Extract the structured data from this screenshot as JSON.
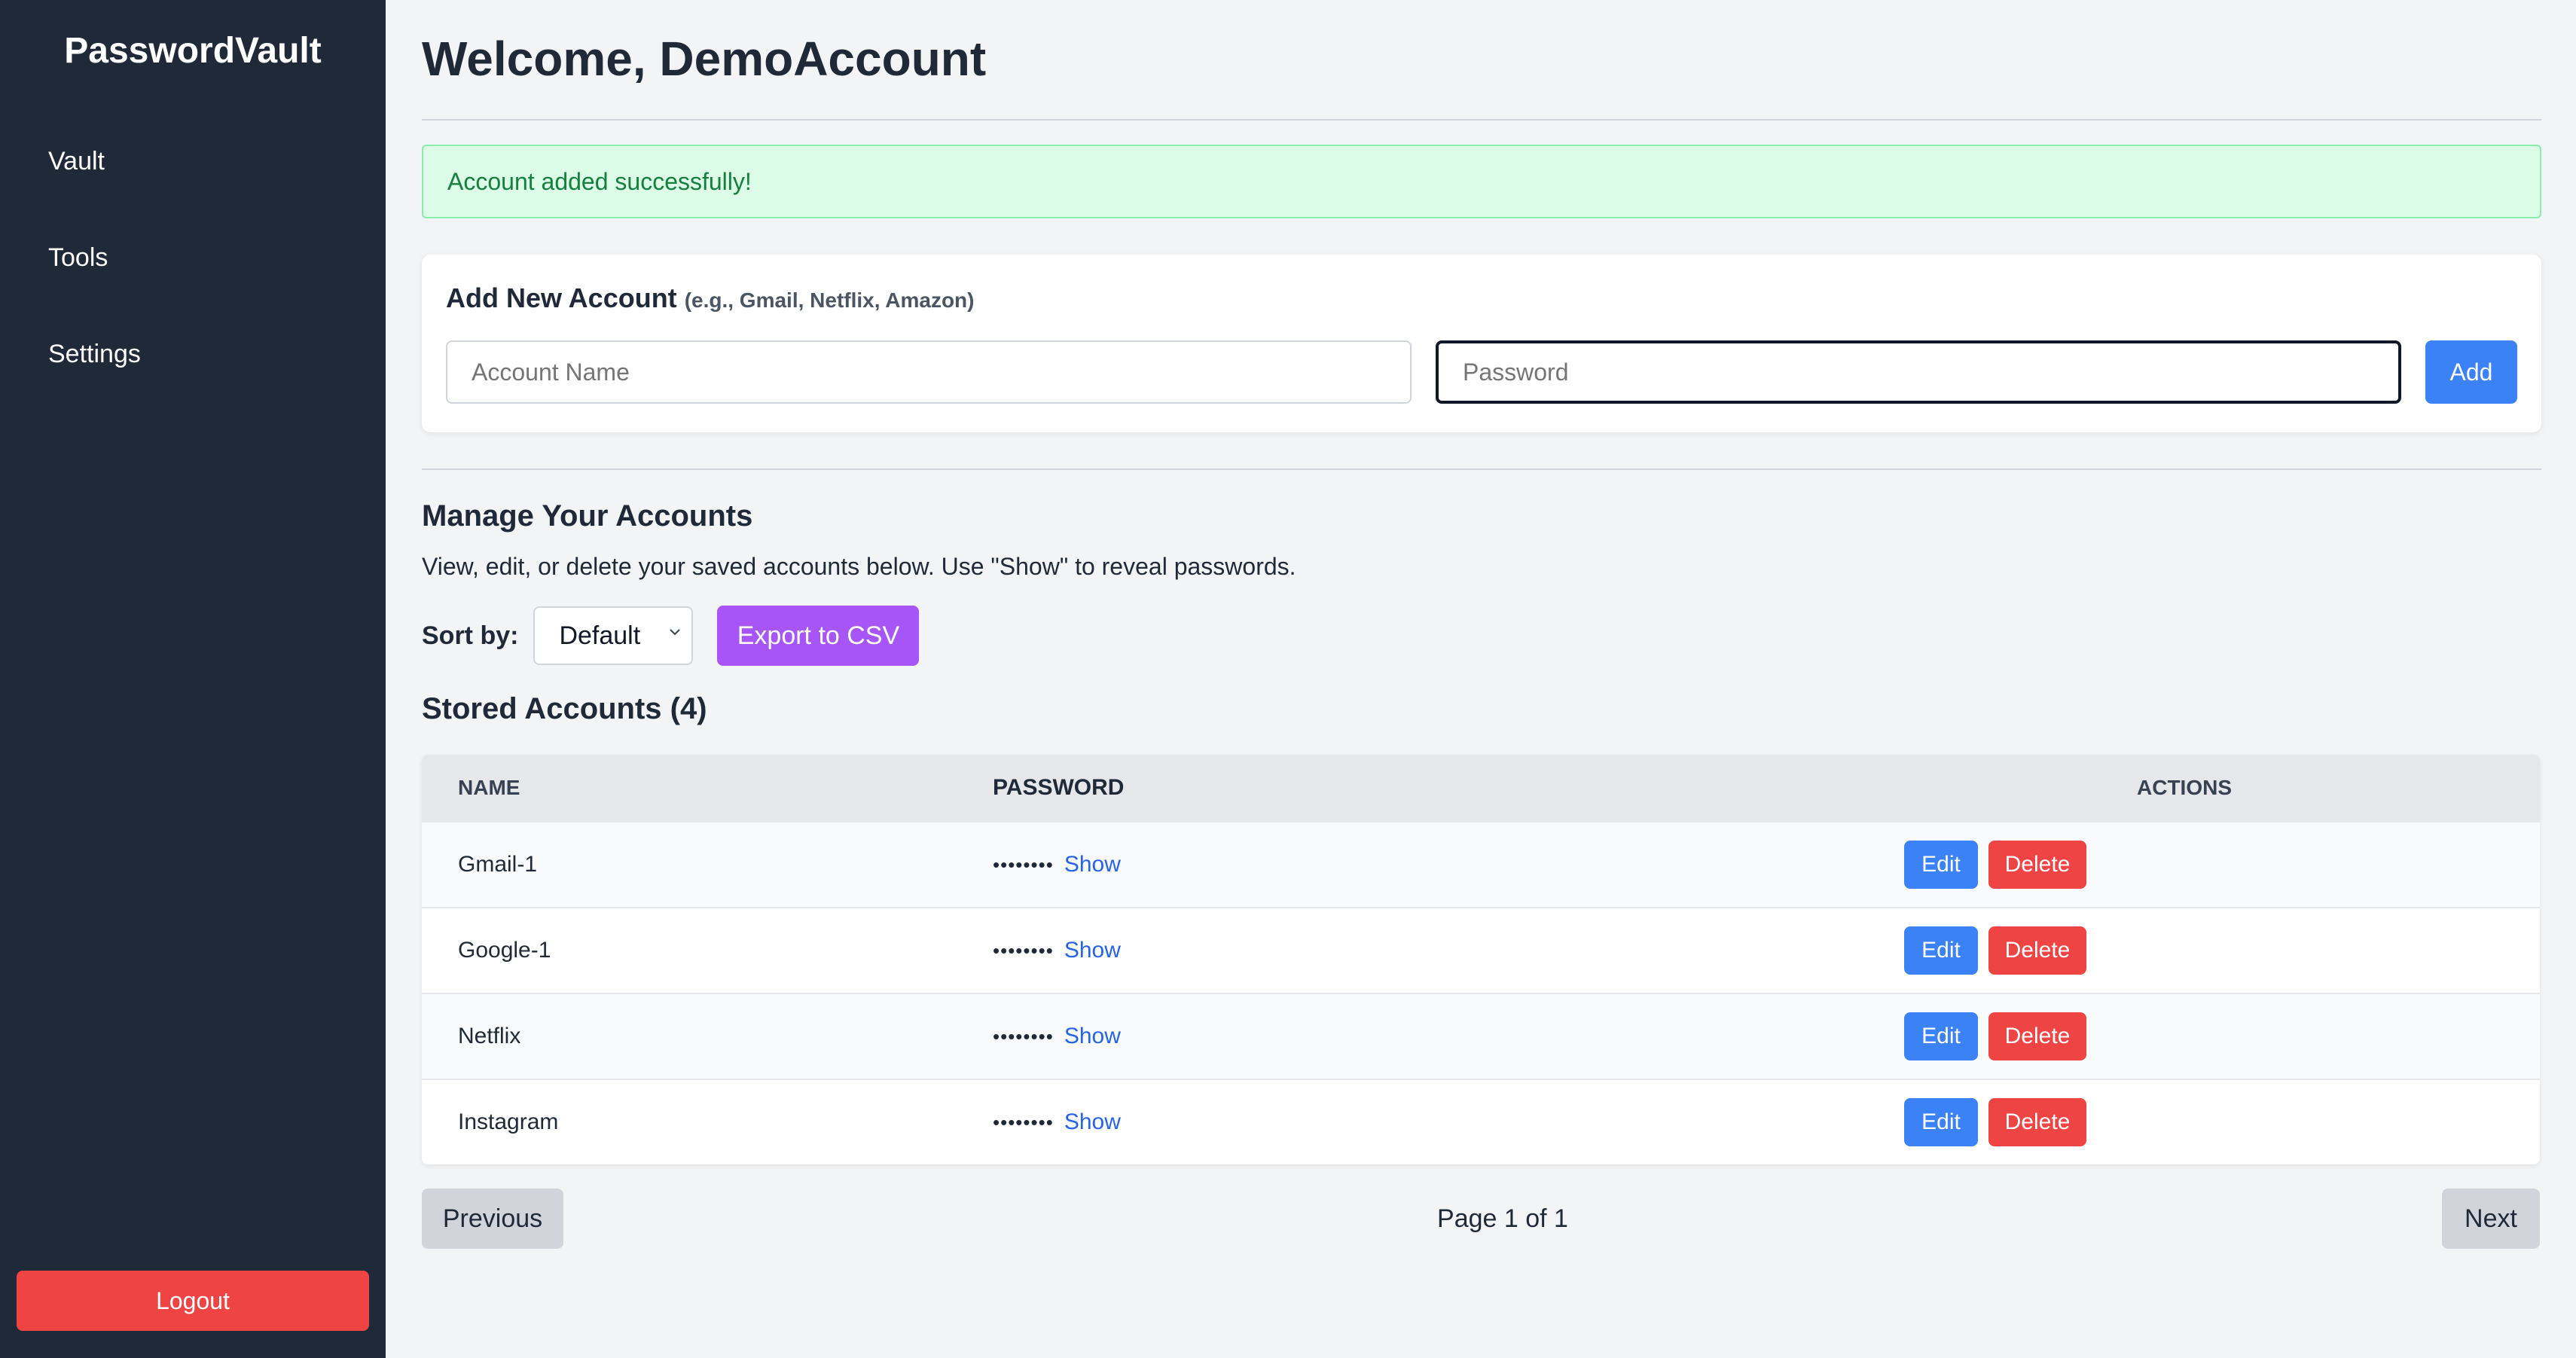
{
  "sidebar": {
    "brand": "PasswordVault",
    "items": [
      {
        "label": "Vault"
      },
      {
        "label": "Tools"
      },
      {
        "label": "Settings"
      }
    ],
    "logout_label": "Logout"
  },
  "header": {
    "title": "Welcome, DemoAccount"
  },
  "alert": {
    "message": "Account added successfully!",
    "color": "#dcfce7"
  },
  "add_form": {
    "title": "Add New Account",
    "hint": "(e.g., Gmail, Netflix, Amazon)",
    "name_placeholder": "Account Name",
    "password_placeholder": "Password",
    "add_label": "Add"
  },
  "manage": {
    "title": "Manage Your Accounts",
    "description": "View, edit, or delete your saved accounts below. Use \"Show\" to reveal passwords.",
    "sort_label": "Sort by:",
    "sort_value": "Default",
    "export_label": "Export to CSV",
    "stored_title": "Stored Accounts (4)"
  },
  "table": {
    "headers": {
      "name": "NAME",
      "password": "PASSWORD",
      "actions": "ACTIONS"
    },
    "rows": [
      {
        "name": "Gmail-1",
        "masked": "••••••••",
        "show": "Show",
        "edit": "Edit",
        "delete": "Delete"
      },
      {
        "name": "Google-1",
        "masked": "••••••••",
        "show": "Show",
        "edit": "Edit",
        "delete": "Delete"
      },
      {
        "name": "Netflix",
        "masked": "••••••••",
        "show": "Show",
        "edit": "Edit",
        "delete": "Delete"
      },
      {
        "name": "Instagram",
        "masked": "••••••••",
        "show": "Show",
        "edit": "Edit",
        "delete": "Delete"
      }
    ]
  },
  "pagination": {
    "previous": "Previous",
    "info": "Page 1 of 1",
    "next": "Next"
  },
  "colors": {
    "sidebar": "#1f2937",
    "primary": "#3b82f6",
    "danger": "#ef4444",
    "export": "#a855f7"
  }
}
